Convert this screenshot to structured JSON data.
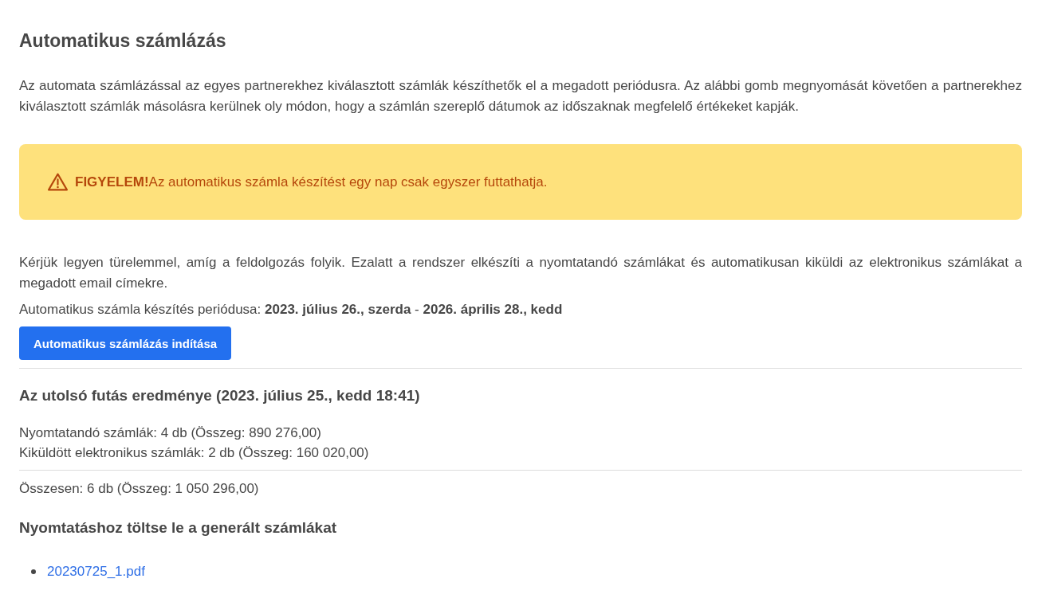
{
  "page": {
    "title": "Automatikus számlázás"
  },
  "intro": "Az automata számlázással az egyes partnerekhez kiválasztott számlák készíthetők el a megadott periódusra. Az alábbi gomb megnyomását követően a partnerekhez kiválasztott számlák másolásra kerülnek oly módon, hogy a számlán szereplő dátumok az időszaknak megfelelő értékeket kapják.",
  "alert": {
    "text": "**FIGYELEM!**Az automatikus számla készítést egy nap csak egyszer futtathatja."
  },
  "notice": "Kérjük legyen türelemmel, amíg a feldolgozás folyik. Ezalatt a rendszer elkészíti a nyomtatandó számlákat és automatikusan kiküldi az elektronikus számlákat a megadott email címekre.",
  "period": "Automatikus számla készítés periódusa: **2023. július 26., szerda** - **2026. április 28., kedd**",
  "start_button": {
    "label": "Automatikus számlázás indítása"
  },
  "last_run": {
    "heading": "Az utolsó futás eredménye (2023. július 25., kedd 18:41)",
    "lines": [
      "Nyomtatandó számlák: 4 db (Összeg: 890 276,00)",
      "Kiküldött elektronikus számlák: 2 db (Összeg: 160 020,00)"
    ],
    "total": "Összesen: 6 db (Összeg: 1 050 296,00)"
  },
  "downloads": {
    "heading": "Nyomtatáshoz töltse le a generált számlákat",
    "files": [
      "20230725_1.pdf"
    ]
  }
}
